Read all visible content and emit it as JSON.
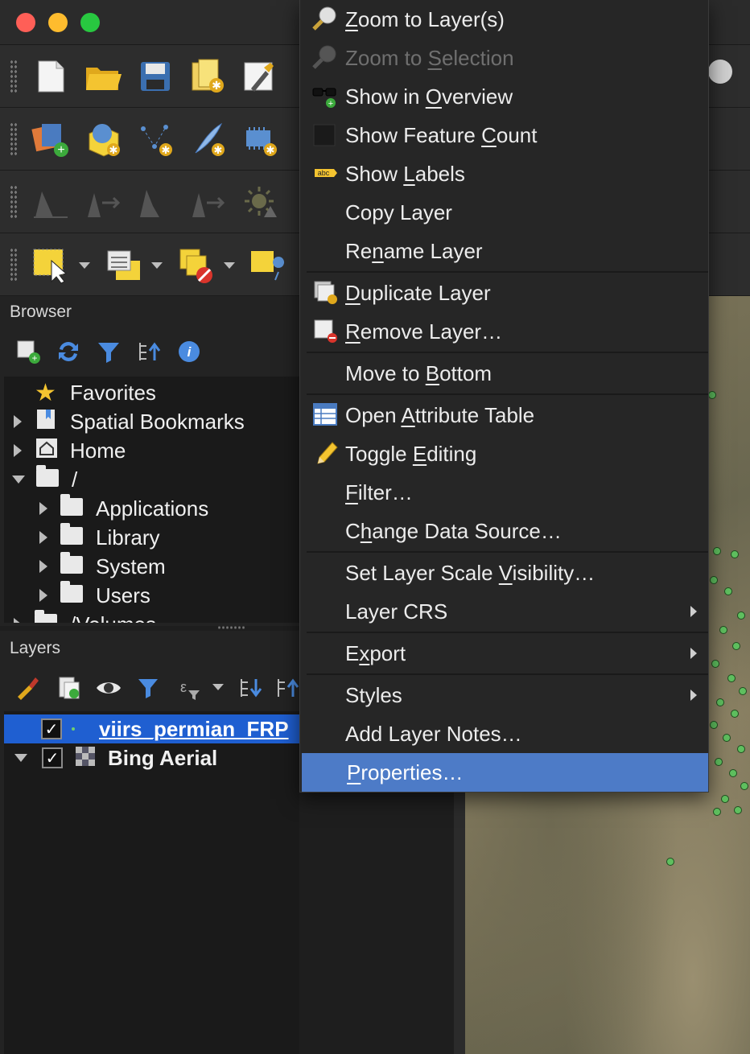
{
  "window": {
    "title": ""
  },
  "browser": {
    "title": "Browser",
    "tree": [
      {
        "label": "Favorites",
        "icon": "star-icon",
        "expand": "none",
        "indent": 0
      },
      {
        "label": "Spatial Bookmarks",
        "icon": "bookmark-icon",
        "expand": "collapsed",
        "indent": 0
      },
      {
        "label": "Home",
        "icon": "home-icon",
        "expand": "collapsed",
        "indent": 0
      },
      {
        "label": "/",
        "icon": "folder-icon",
        "expand": "expanded",
        "indent": 0
      },
      {
        "label": "Applications",
        "icon": "folder-icon",
        "expand": "collapsed",
        "indent": 1
      },
      {
        "label": "Library",
        "icon": "folder-icon",
        "expand": "collapsed",
        "indent": 1
      },
      {
        "label": "System",
        "icon": "folder-icon",
        "expand": "collapsed",
        "indent": 1
      },
      {
        "label": "Users",
        "icon": "folder-icon",
        "expand": "collapsed",
        "indent": 1
      },
      {
        "label": "/Volumes",
        "icon": "folder-icon",
        "expand": "collapsed",
        "indent": 0
      }
    ]
  },
  "layers": {
    "title": "Layers",
    "items": [
      {
        "label": "viirs_permian_FRP",
        "checked": true,
        "selected": true
      },
      {
        "label": "Bing Aerial",
        "checked": true,
        "selected": false
      }
    ]
  },
  "context_menu": {
    "items": [
      {
        "pre": "",
        "u": "Z",
        "post": "oom to Layer(s)",
        "icon": "zoom-layer-icon",
        "disabled": false
      },
      {
        "pre": "Zoom to ",
        "u": "S",
        "post": "election",
        "icon": "zoom-selection-icon",
        "disabled": true
      },
      {
        "pre": "Show in ",
        "u": "O",
        "post": "verview",
        "icon": "overview-glasses-icon",
        "disabled": false
      },
      {
        "pre": "Show Feature ",
        "u": "C",
        "post": "ount",
        "icon": "feature-count-icon",
        "disabled": false
      },
      {
        "pre": "Show ",
        "u": "L",
        "post": "abels",
        "icon": "labels-abc-icon",
        "disabled": false
      },
      {
        "pre": "Copy Layer",
        "u": "",
        "post": "",
        "icon": "",
        "disabled": false
      },
      {
        "pre": "Re",
        "u": "n",
        "post": "ame Layer",
        "icon": "",
        "disabled": false
      },
      {
        "pre": "",
        "u": "D",
        "post": "uplicate Layer",
        "icon": "duplicate-layer-icon",
        "disabled": false
      },
      {
        "pre": "",
        "u": "R",
        "post": "emove Layer…",
        "icon": "remove-layer-icon",
        "disabled": false
      },
      {
        "pre": "Move to ",
        "u": "B",
        "post": "ottom",
        "icon": "",
        "disabled": false
      },
      {
        "pre": "Open ",
        "u": "A",
        "post": "ttribute Table",
        "icon": "attribute-table-icon",
        "disabled": false
      },
      {
        "pre": "Toggle ",
        "u": "E",
        "post": "diting",
        "icon": "pencil-icon",
        "disabled": false
      },
      {
        "pre": "",
        "u": "F",
        "post": "ilter…",
        "icon": "",
        "disabled": false
      },
      {
        "pre": "C",
        "u": "h",
        "post": "ange Data Source…",
        "icon": "",
        "disabled": false
      },
      {
        "pre": "Set Layer Scale ",
        "u": "V",
        "post": "isibility…",
        "icon": "",
        "disabled": false
      },
      {
        "pre": "Layer CRS",
        "u": "",
        "post": "",
        "icon": "",
        "disabled": false
      },
      {
        "pre": "E",
        "u": "x",
        "post": "port",
        "icon": "",
        "disabled": false
      },
      {
        "pre": "Styles",
        "u": "",
        "post": "",
        "icon": "",
        "disabled": false
      },
      {
        "pre": "Add Layer Notes…",
        "u": "",
        "post": "",
        "icon": "",
        "disabled": false
      },
      {
        "pre": "",
        "u": "P",
        "post": "roperties…",
        "icon": "",
        "disabled": false
      }
    ]
  },
  "colors": {
    "menu_highlight": "#4d7bc7",
    "layer_selected": "#1f5fd1",
    "map_point": "#5fbf5f"
  }
}
